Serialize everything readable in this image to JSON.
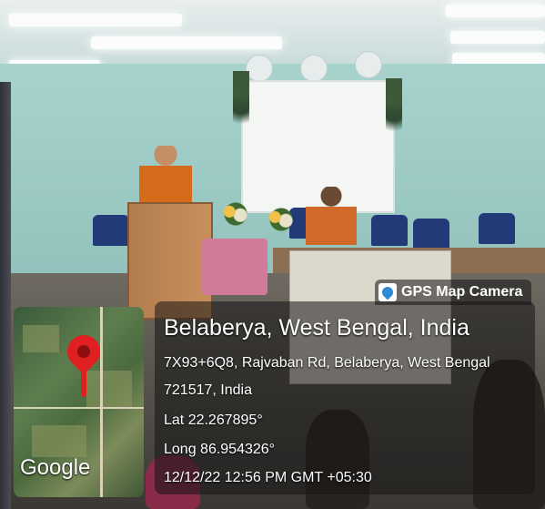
{
  "badge": {
    "label": "GPS Map Camera",
    "icon": "map-pin-icon"
  },
  "location": {
    "title": "Belaberya, West Bengal, India",
    "address_line1": "7X93+6Q8, Rajvaban Rd, Belaberya, West Bengal",
    "address_line2": "721517, India",
    "lat": "Lat 22.267895°",
    "long": "Long 86.954326°",
    "datetime": "12/12/22 12:56 PM GMT +05:30"
  },
  "map": {
    "attribution": "Google",
    "pin_color": "#e02020"
  },
  "colors": {
    "overlay": "#141414",
    "text": "#ffffff",
    "robe": "#d66a1b"
  }
}
